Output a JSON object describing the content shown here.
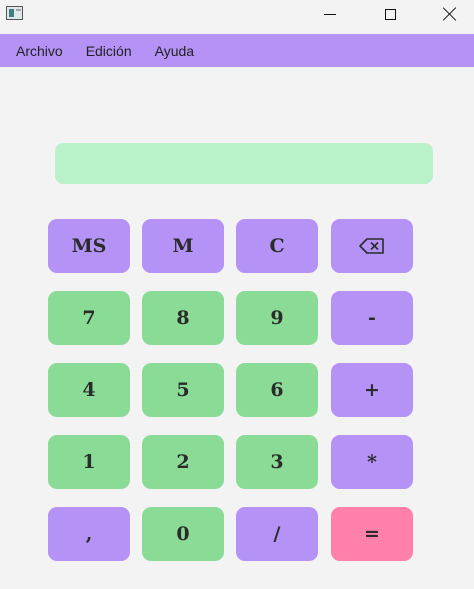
{
  "window": {
    "title": ""
  },
  "menu": {
    "items": [
      "Archivo",
      "Edición",
      "Ayuda"
    ]
  },
  "display": {
    "value": ""
  },
  "keys": {
    "ms": "MS",
    "m": "M",
    "c": "C",
    "backspace_icon": "backspace-icon",
    "k7": "7",
    "k8": "8",
    "k9": "9",
    "minus": "-",
    "k4": "4",
    "k5": "5",
    "k6": "6",
    "plus": "+",
    "k1": "1",
    "k2": "2",
    "k3": "3",
    "multiply": "*",
    "comma": ",",
    "k0": "0",
    "divide": "/",
    "equals": "="
  },
  "colors": {
    "menubar": "#b592f5",
    "operator_key": "#b592f5",
    "digit_key": "#8adb96",
    "equals_key": "#ff80ab",
    "display": "#b9f2c8",
    "background": "#f3f3f3"
  }
}
